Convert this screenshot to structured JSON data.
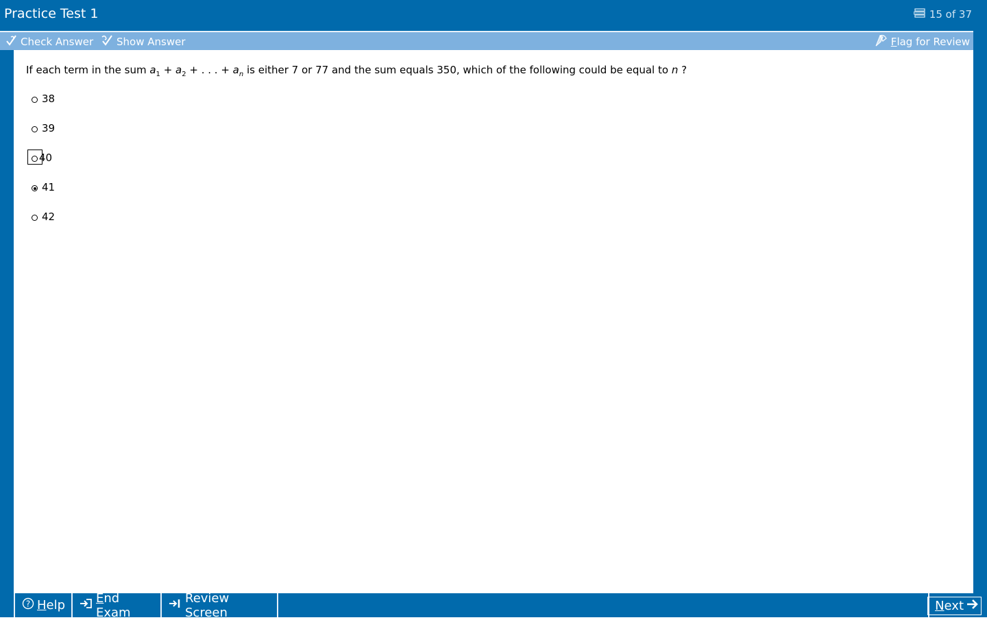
{
  "header": {
    "title": "Practice Test 1",
    "counter": "15 of 37"
  },
  "toolbar": {
    "check_answer": "Check Answer",
    "show_answer": "Show Answer",
    "flag_for_review": "Flag for Review"
  },
  "question": {
    "part1": "If each term in the sum ",
    "a": "a",
    "sub1": "1",
    "plus1": " + ",
    "sub2": "2",
    "plus2": " + . . . + ",
    "subn": "n",
    "part2": " is either 7 or 77 and the sum equals 350, which of the following could be equal to ",
    "n": "n",
    "end": " ?"
  },
  "choices": [
    {
      "label": "38",
      "selected": false
    },
    {
      "label": "39",
      "selected": false
    },
    {
      "label": "40",
      "selected": false,
      "focused": true
    },
    {
      "label": "41",
      "selected": true
    },
    {
      "label": "42",
      "selected": false
    }
  ],
  "footer": {
    "help": "Help",
    "end_exam": "End Exam",
    "review_screen": "Review Screen",
    "next": "Next"
  },
  "colors": {
    "primary": "#016aac",
    "toolbar": "#7eb1df"
  }
}
